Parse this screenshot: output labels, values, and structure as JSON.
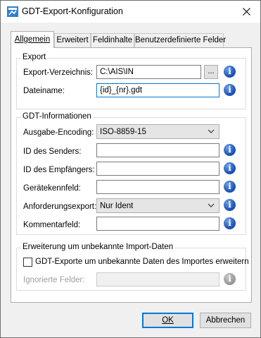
{
  "window": {
    "title": "GDT-Export-Konfiguration",
    "close_symbol": "✕",
    "icon": "app-icon"
  },
  "tabs": [
    {
      "label": "Allgemein",
      "active": true
    },
    {
      "label": "Erweitert",
      "active": false
    },
    {
      "label": "Feldinhalte",
      "active": false
    },
    {
      "label": "Benutzerdefinierte Felder",
      "active": false
    }
  ],
  "export_group": {
    "title": "Export",
    "directory_label": "Export-Verzeichnis:",
    "directory_value": "C:\\AIS\\IN",
    "browse_label": "...",
    "filename_label": "Dateiname:",
    "filename_value": "{id}_{nr}.gdt"
  },
  "gdt_group": {
    "title": "GDT-Informationen",
    "encoding_label": "Ausgabe-Encoding:",
    "encoding_value": "ISO-8859-15",
    "sender_label": "ID des Senders:",
    "sender_value": "",
    "receiver_label": "ID des Empfängers:",
    "receiver_value": "",
    "device_label": "Gerätekennfeld:",
    "device_value": "",
    "request_label": "Anforderungsexport:",
    "request_value": "Nur Ident",
    "comment_label": "Kommentarfeld:",
    "comment_value": ""
  },
  "extension_group": {
    "title": "Erweiterung um unbekannte Import-Daten",
    "checkbox_label": "GDT-Exporte um unbekannte Daten des Importes erweitern",
    "checkbox_checked": false,
    "ignored_label": "Ignorierte Felder:",
    "ignored_value": ""
  },
  "buttons": {
    "ok_label": "OK",
    "cancel_label": "Abbrechen"
  },
  "info_glyph": "i"
}
